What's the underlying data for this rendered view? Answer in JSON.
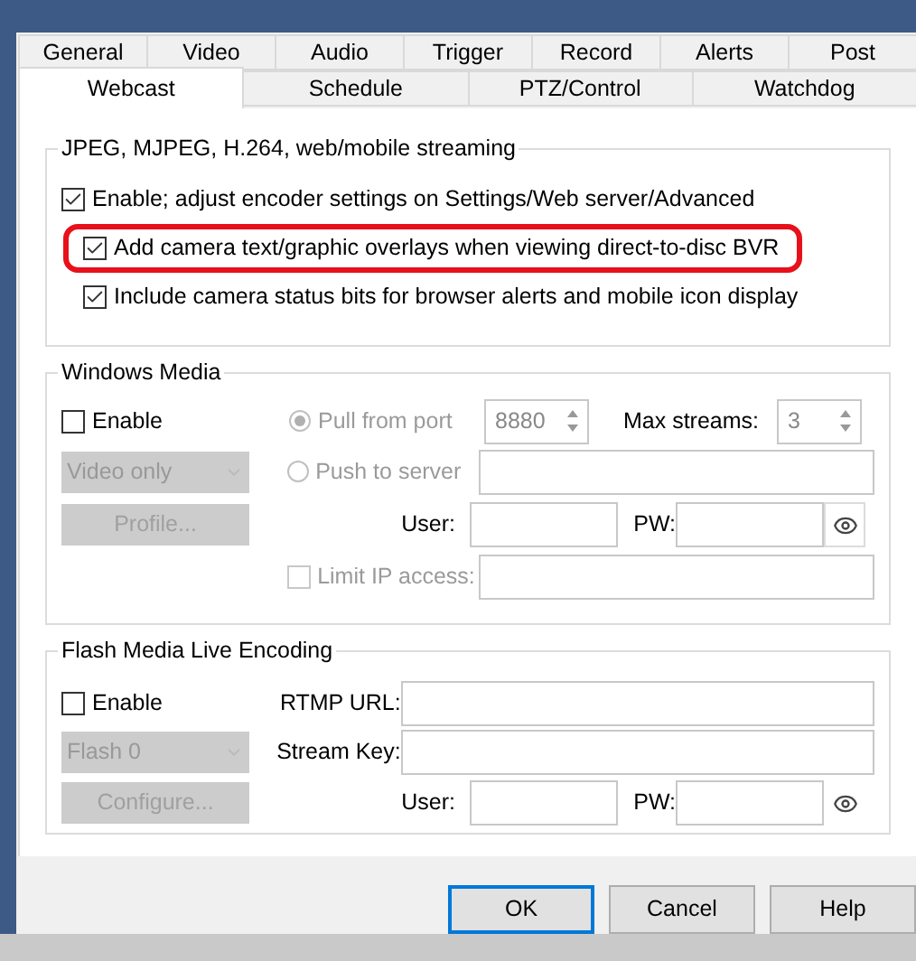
{
  "tab_rows": [
    {
      "tabs": [
        {
          "label": "General",
          "selected": false
        },
        {
          "label": "Video",
          "selected": false
        },
        {
          "label": "Audio",
          "selected": false
        },
        {
          "label": "Trigger",
          "selected": false
        },
        {
          "label": "Record",
          "selected": false
        },
        {
          "label": "Alerts",
          "selected": false
        },
        {
          "label": "Post",
          "selected": false
        }
      ]
    },
    {
      "tabs": [
        {
          "label": "Webcast",
          "selected": true
        },
        {
          "label": "Schedule",
          "selected": false
        },
        {
          "label": "PTZ/Control",
          "selected": false
        },
        {
          "label": "Watchdog",
          "selected": false
        }
      ]
    }
  ],
  "streaming": {
    "title": "JPEG, MJPEG, H.264, web/mobile streaming",
    "options": [
      {
        "label": "Enable; adjust encoder settings on Settings/Web server/Advanced",
        "checked": true,
        "highlighted": false,
        "children": [
          {
            "label": "Add camera text/graphic overlays when viewing direct-to-disc BVR",
            "checked": true,
            "highlighted": true
          },
          {
            "label": "Include camera status bits for browser alerts and mobile icon display",
            "checked": true,
            "highlighted": false
          }
        ]
      }
    ]
  },
  "windows_media": {
    "title": "Windows Media",
    "enable": {
      "label": "Enable",
      "checked": false
    },
    "format_select": {
      "value": "Video only",
      "disabled": true
    },
    "profile_button": {
      "label": "Profile...",
      "disabled": true
    },
    "pull_from_port": {
      "label": "Pull from port",
      "selected": true,
      "disabled": true
    },
    "port": {
      "value": "8880"
    },
    "max_streams": {
      "label": "Max streams:",
      "value": "3"
    },
    "push_to_server": {
      "label": "Push to server",
      "selected": false,
      "disabled": true
    },
    "user": {
      "label": "User:"
    },
    "pw": {
      "label": "PW:"
    },
    "limit_ip": {
      "label": "Limit IP access:",
      "checked": false,
      "disabled": true
    }
  },
  "flash": {
    "title": "Flash Media Live Encoding",
    "enable": {
      "label": "Enable",
      "checked": false
    },
    "rtmp_url": {
      "label": "RTMP URL:"
    },
    "source_select": {
      "value": "Flash 0",
      "disabled": true
    },
    "stream_key": {
      "label": "Stream Key:"
    },
    "configure_button": {
      "label": "Configure...",
      "disabled": true
    },
    "user": {
      "label": "User:"
    },
    "pw": {
      "label": "PW:"
    }
  },
  "buttons": [
    {
      "label": "OK",
      "default": true
    },
    {
      "label": "Cancel",
      "default": false
    },
    {
      "label": "Help",
      "default": false
    }
  ]
}
